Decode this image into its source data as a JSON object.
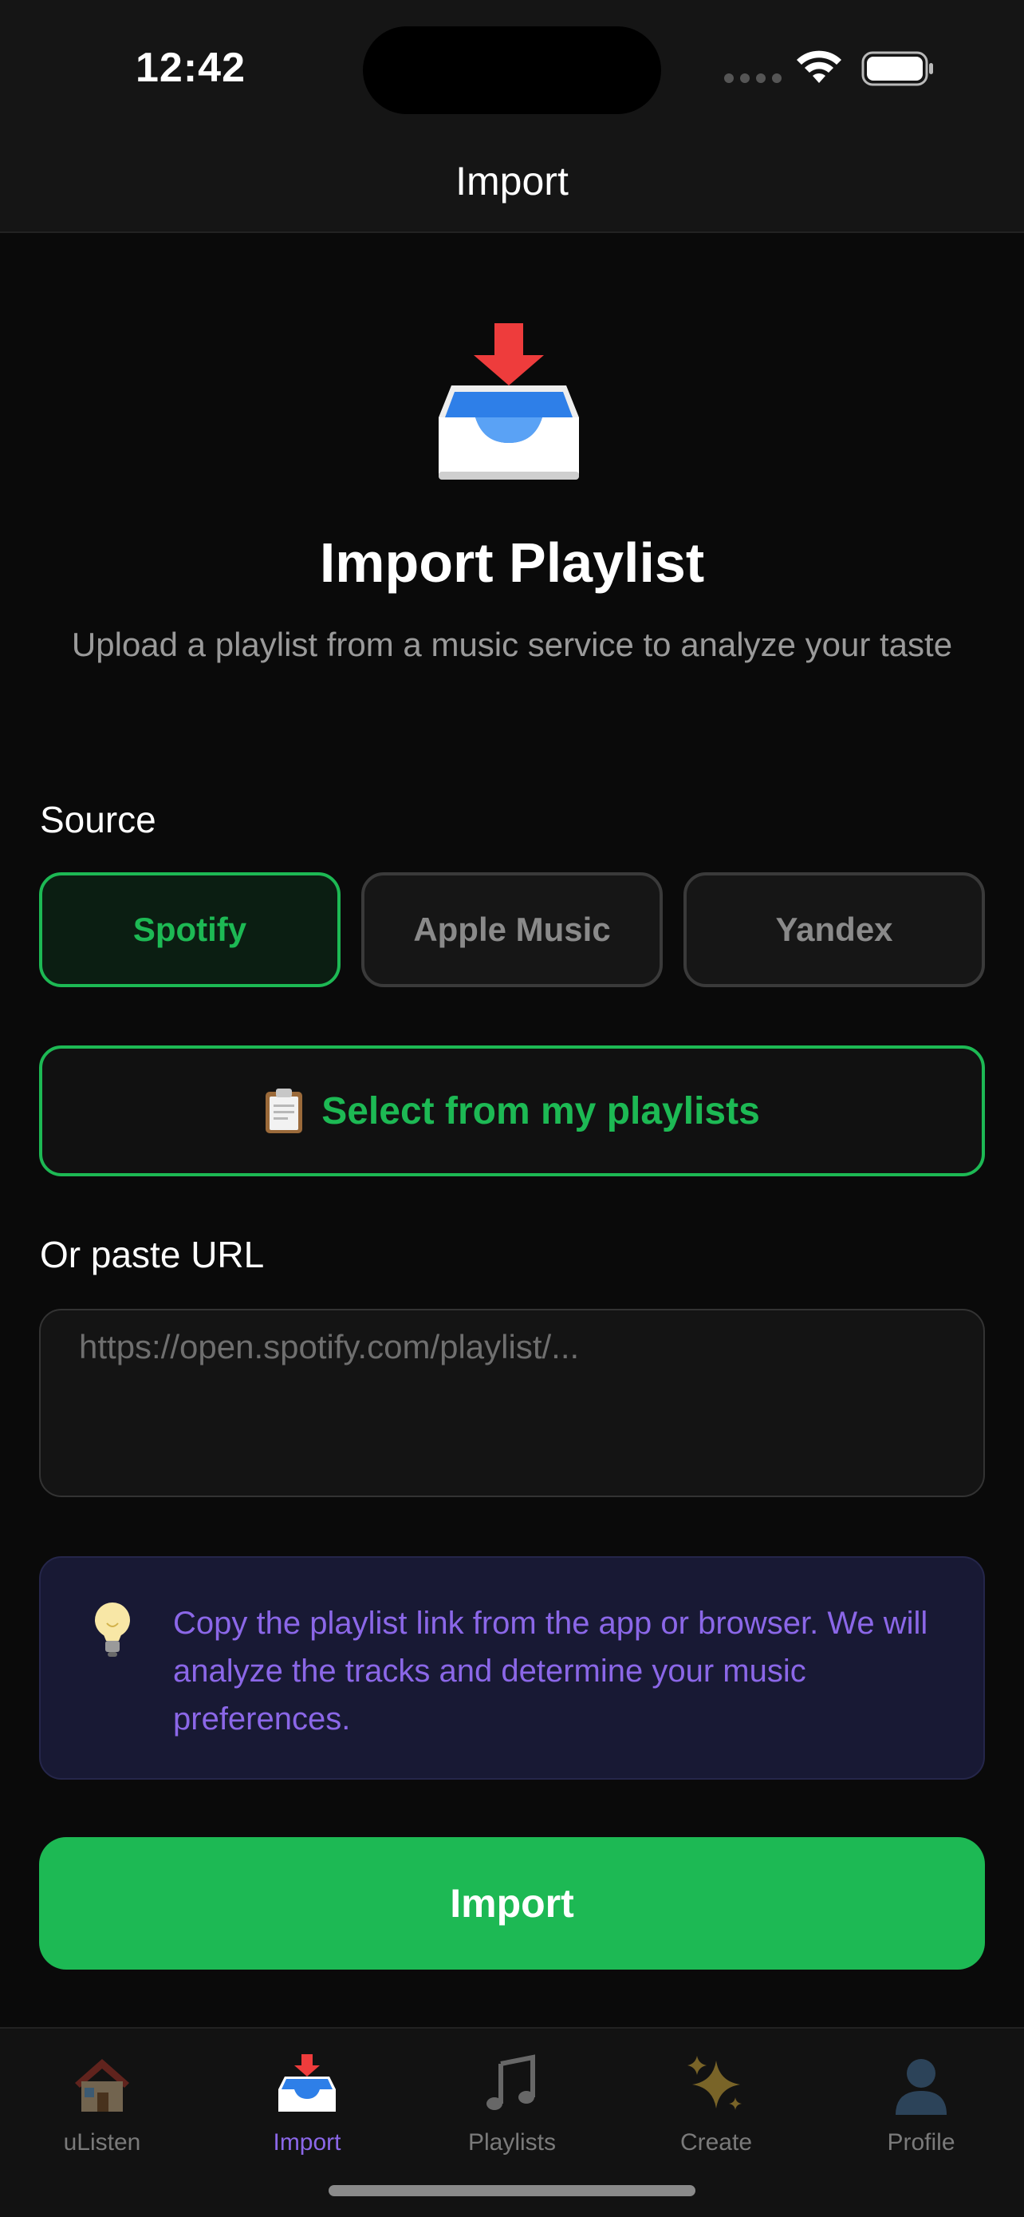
{
  "status_bar": {
    "time": "12:42",
    "icons": [
      "signal-dots-icon",
      "wifi-icon",
      "battery-icon"
    ]
  },
  "header": {
    "title": "Import"
  },
  "hero": {
    "icon": "inbox-tray-icon",
    "title": "Import Playlist",
    "subtitle": "Upload a playlist from a music service to analyze your taste"
  },
  "source": {
    "label": "Source",
    "options": [
      {
        "label": "Spotify",
        "selected": true
      },
      {
        "label": "Apple Music",
        "selected": false
      },
      {
        "label": "Yandex",
        "selected": false
      }
    ]
  },
  "select_playlists": {
    "icon": "clipboard-icon",
    "label": "Select from my playlists"
  },
  "url": {
    "label": "Or paste URL",
    "value": "",
    "placeholder": "https://open.spotify.com/playlist/..."
  },
  "tip": {
    "icon": "light-bulb-icon",
    "text": "Copy the playlist link from the app or browser. We will analyze the tracks and determine your music preferences."
  },
  "import_button": {
    "label": "Import"
  },
  "tab_bar": {
    "tabs": [
      {
        "label": "uListen",
        "icon": "house-icon",
        "active": false
      },
      {
        "label": "Import",
        "icon": "inbox-tray-icon",
        "active": true
      },
      {
        "label": "Playlists",
        "icon": "music-notes-icon",
        "active": false
      },
      {
        "label": "Create",
        "icon": "sparkles-icon",
        "active": false
      },
      {
        "label": "Profile",
        "icon": "user-silhouette-icon",
        "active": false
      }
    ]
  },
  "colors": {
    "background": "#0a0a0a",
    "accent_green": "#1db954",
    "accent_purple": "#8b67e8",
    "muted_text": "#9a9a9a"
  }
}
